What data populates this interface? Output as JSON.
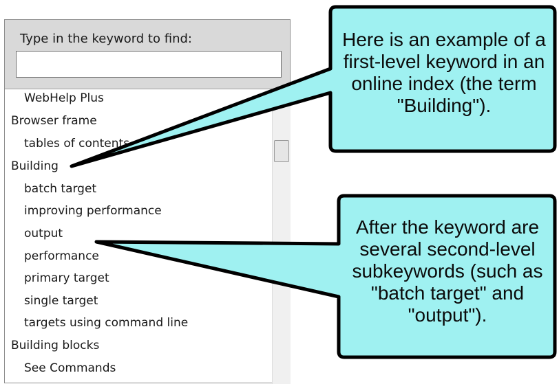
{
  "search": {
    "label": "Type in the keyword to find:",
    "value": "",
    "placeholder": ""
  },
  "index_items": [
    {
      "label": "WebHelp Plus",
      "level": 2
    },
    {
      "label": "Browser frame",
      "level": 1
    },
    {
      "label": "tables of contents",
      "level": 2
    },
    {
      "label": "Building",
      "level": 1
    },
    {
      "label": "batch target",
      "level": 2
    },
    {
      "label": "improving performance",
      "level": 2
    },
    {
      "label": "output",
      "level": 2
    },
    {
      "label": "performance",
      "level": 2
    },
    {
      "label": "primary target",
      "level": 2
    },
    {
      "label": "single target",
      "level": 2
    },
    {
      "label": "targets using command line",
      "level": 2
    },
    {
      "label": "Building blocks",
      "level": 1
    },
    {
      "label": "See Commands",
      "level": 2
    }
  ],
  "callouts": {
    "top": "Here is an example of a first-level keyword in an online index (the term \"Building\").",
    "bottom": "After the keyword are several second-level subkeywords (such as \"batch target\" and \"output\")."
  },
  "colors": {
    "callout_fill": "#9ff1f1",
    "callout_stroke": "#000000",
    "header_bg": "#d9d9d9"
  }
}
